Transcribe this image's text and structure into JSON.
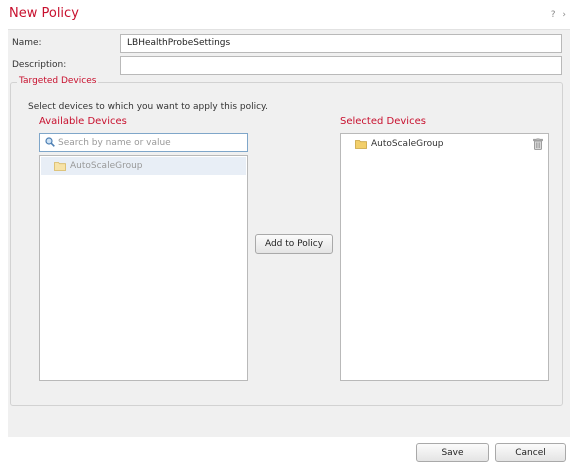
{
  "dialog": {
    "title": "New Policy",
    "controls": "? ×"
  },
  "form": {
    "name_label": "Name:",
    "name_value": "LBHealthProbeSettings",
    "description_label": "Description:",
    "description_value": ""
  },
  "targeted": {
    "legend": "Targeted Devices",
    "instruction": "Select devices to which you want to apply this policy.",
    "available_title": "Available Devices",
    "search_placeholder": "Search by name or value",
    "available_items": [
      "AutoScaleGroup"
    ],
    "add_button": "Add to Policy",
    "selected_title": "Selected Devices",
    "selected_items": [
      "AutoScaleGroup"
    ]
  },
  "footer": {
    "save_label": "Save",
    "cancel_label": "Cancel"
  },
  "colors": {
    "accent": "#c8102e",
    "selected_row": "#e8eef6",
    "folder": "#f2cf6b"
  }
}
